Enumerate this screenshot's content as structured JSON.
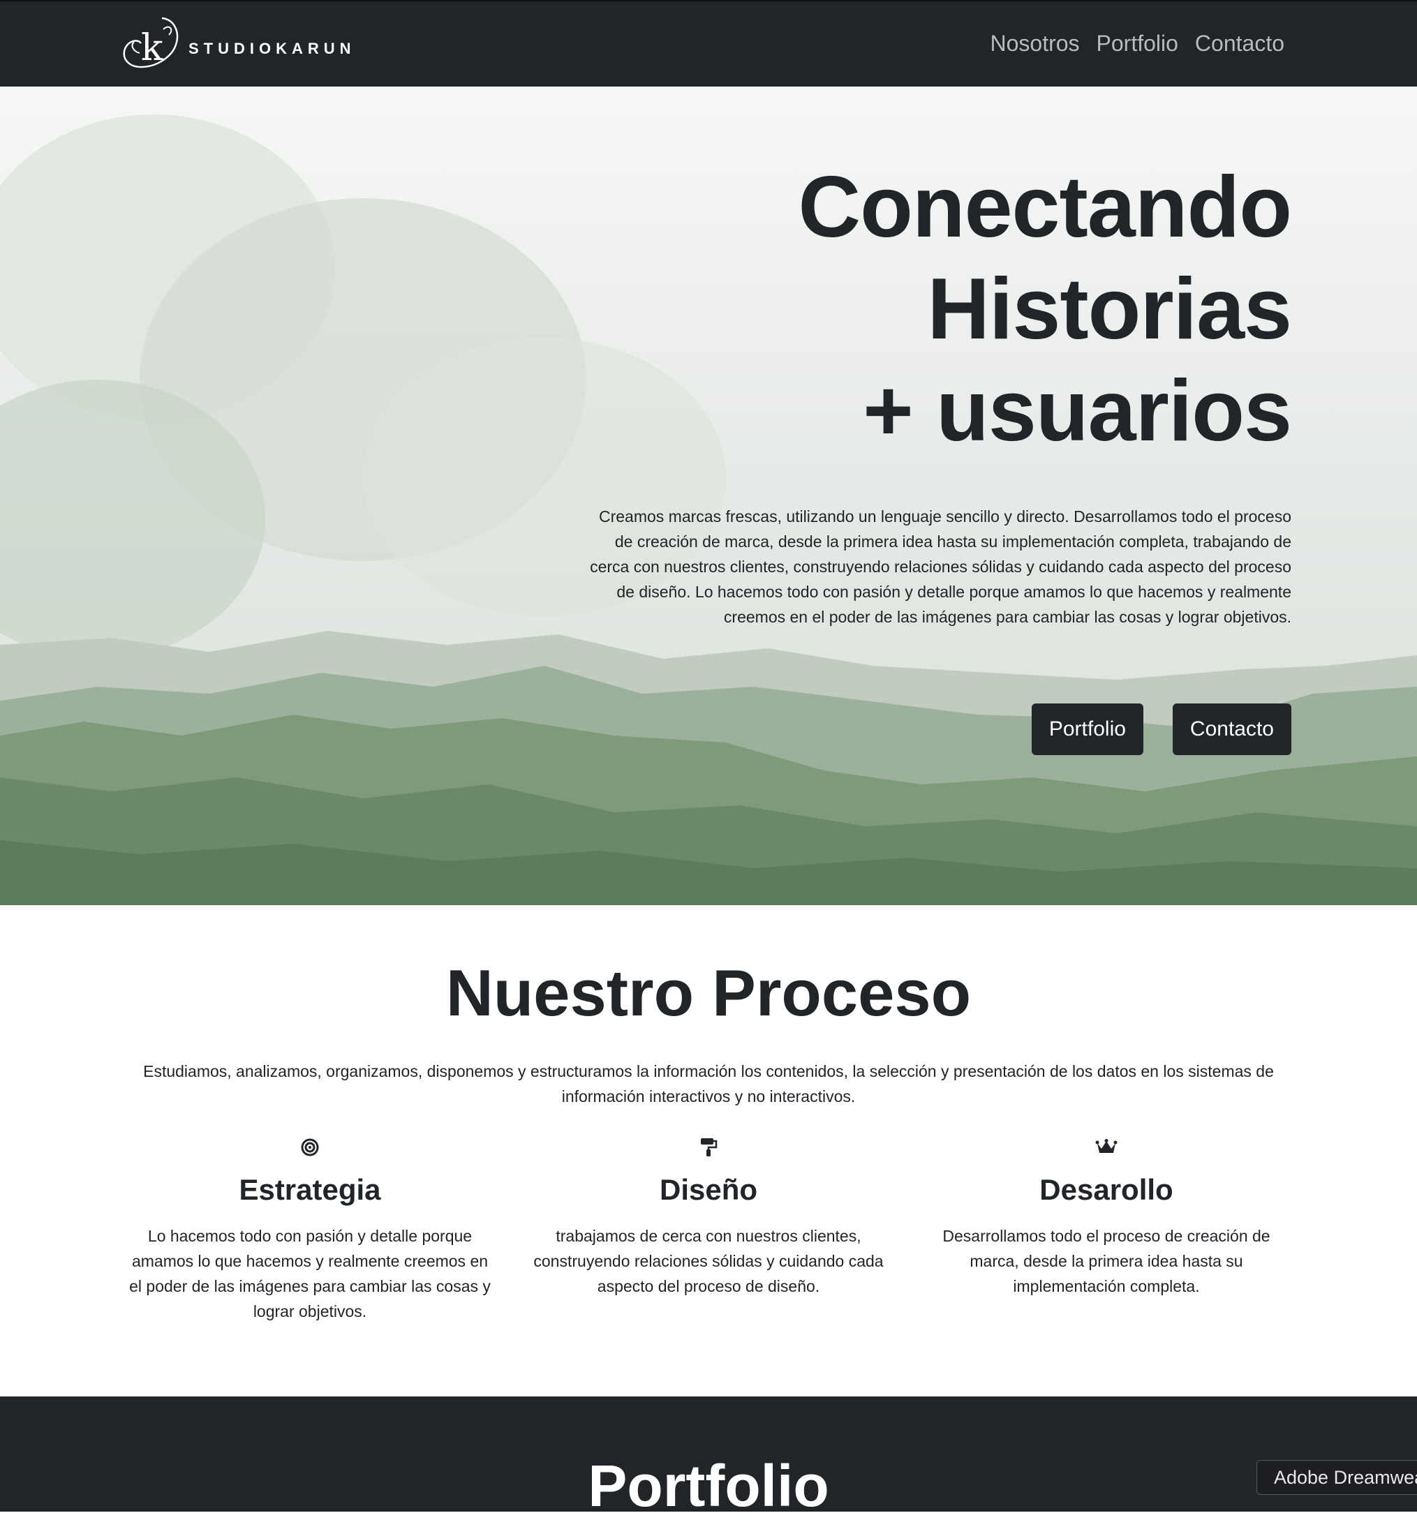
{
  "nav": {
    "logo_letter": "k",
    "brand": "STUDIOKARUN",
    "links": [
      "Nosotros",
      "Portfolio",
      "Contacto"
    ]
  },
  "hero": {
    "title_lines": [
      "Conectando",
      "Historias",
      "+ usuarios"
    ],
    "text": "Creamos marcas frescas, utilizando un lenguaje sencillo y directo. Desarrollamos todo el proceso de creación de marca, desde la primera idea hasta su implementación completa, trabajando de cerca con nuestros clientes, construyendo relaciones sólidas y cuidando cada aspecto del proceso de diseño. Lo hacemos todo con pasión y detalle porque amamos lo que hacemos y realmente creemos en el poder de las imágenes para cambiar las cosas y lograr objetivos.",
    "buttons": [
      "Portfolio",
      "Contacto"
    ]
  },
  "process": {
    "title": "Nuestro Proceso",
    "lead": "Estudiamos, analizamos, organizamos, disponemos y estructuramos la información los contenidos, la selección y presentación de los datos en los sistemas de información interactivos y no interactivos.",
    "columns": [
      {
        "icon": "target-icon",
        "title": "Estrategia",
        "text": "Lo hacemos todo con pasión y detalle porque amamos lo que hacemos y realmente creemos en el poder de las imágenes para cambiar las cosas y lograr objetivos."
      },
      {
        "icon": "paint-roller-icon",
        "title": "Diseño",
        "text": "trabajamos de cerca con nuestros clientes, construyendo relaciones sólidas y cuidando cada aspecto del proceso de diseño."
      },
      {
        "icon": "crown-icon",
        "title": "Desarollo",
        "text": "Desarrollamos todo el proceso de creación de marca, desde la primera idea hasta su implementación completa."
      }
    ]
  },
  "portfolio": {
    "title": "Portfolio"
  },
  "tooltip": {
    "text": "Adobe Dreamweaver"
  },
  "colors": {
    "dark": "#212429",
    "nav_link": "#b8bbbf",
    "white": "#ffffff"
  }
}
